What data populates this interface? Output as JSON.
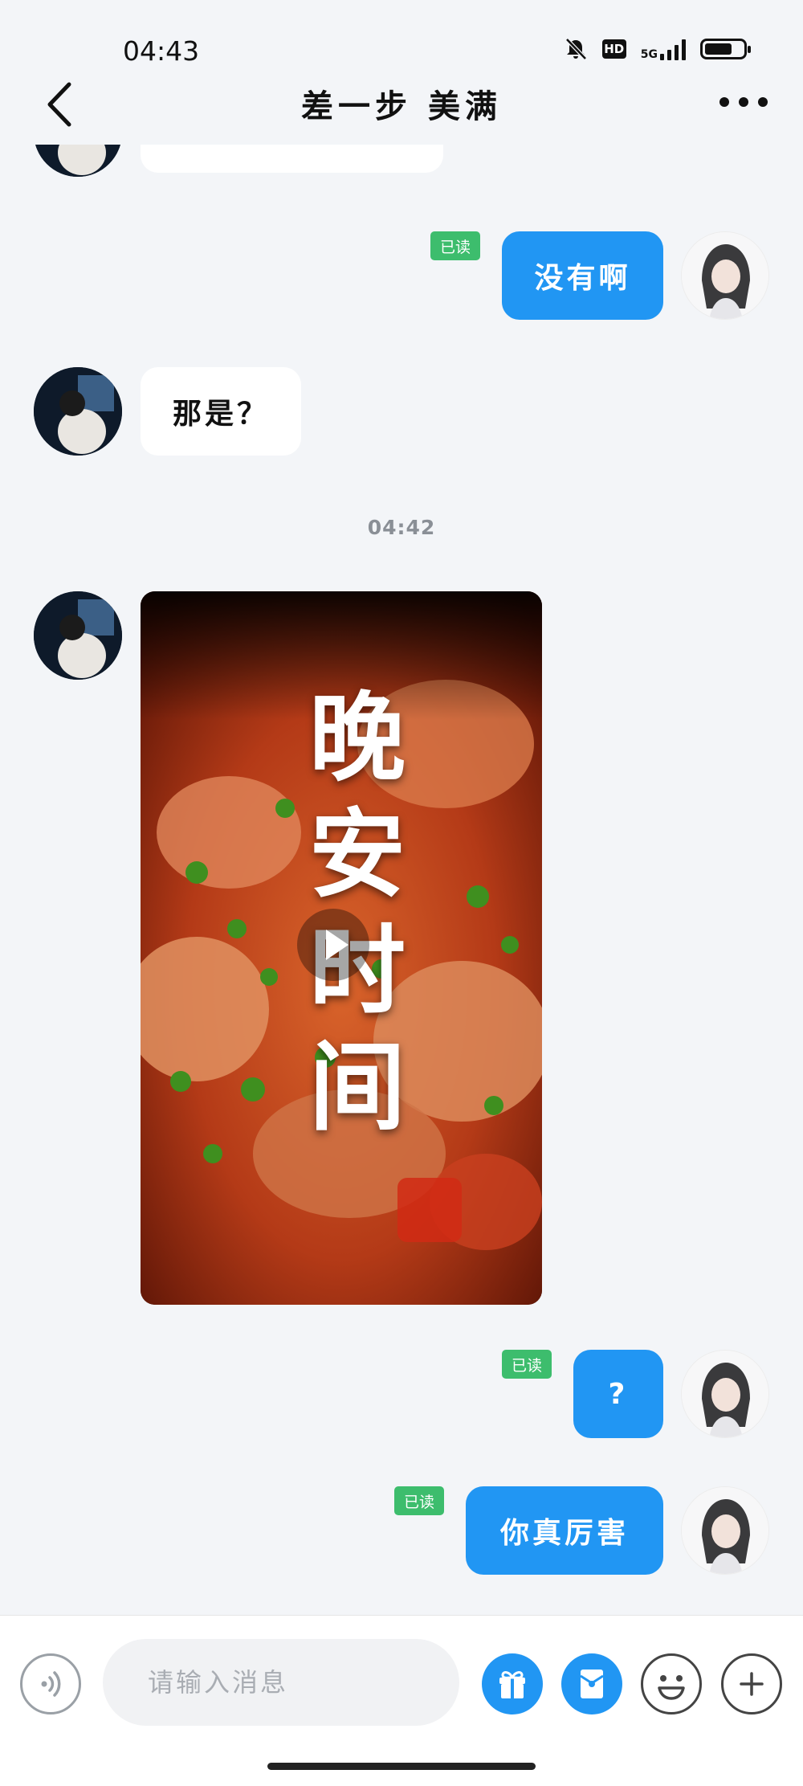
{
  "status_bar": {
    "time": "04:43",
    "icons": [
      "mute-bell-icon",
      "hd-icon",
      "5g-signal-icon",
      "battery-icon"
    ],
    "hd_label": "HD",
    "network_label": "5G",
    "battery_level": 0.72
  },
  "header": {
    "title": "差一步 美满",
    "back_icon": "chevron-left-icon",
    "more_icon": "more-dots-icon"
  },
  "messages": [
    {
      "side": "left",
      "text": "",
      "partial": true
    },
    {
      "side": "right",
      "text": "没有啊",
      "read": "已读"
    },
    {
      "side": "left",
      "text": "那是？"
    },
    {
      "type": "time",
      "text": "04:42"
    },
    {
      "side": "left",
      "type": "video",
      "caption": "晚安时间",
      "icon": "play-icon"
    },
    {
      "side": "right",
      "text": "?",
      "read": "已读"
    },
    {
      "side": "right",
      "text": "你真厉害",
      "read": "已读"
    }
  ],
  "input_bar": {
    "placeholder": "请输入消息",
    "icons": [
      "voice-icon",
      "gift-icon",
      "red-packet-icon",
      "emoji-icon",
      "plus-icon"
    ]
  },
  "colors": {
    "accent": "#2196f3",
    "read_tag": "#3dbd6d",
    "background": "#f3f5f8"
  }
}
